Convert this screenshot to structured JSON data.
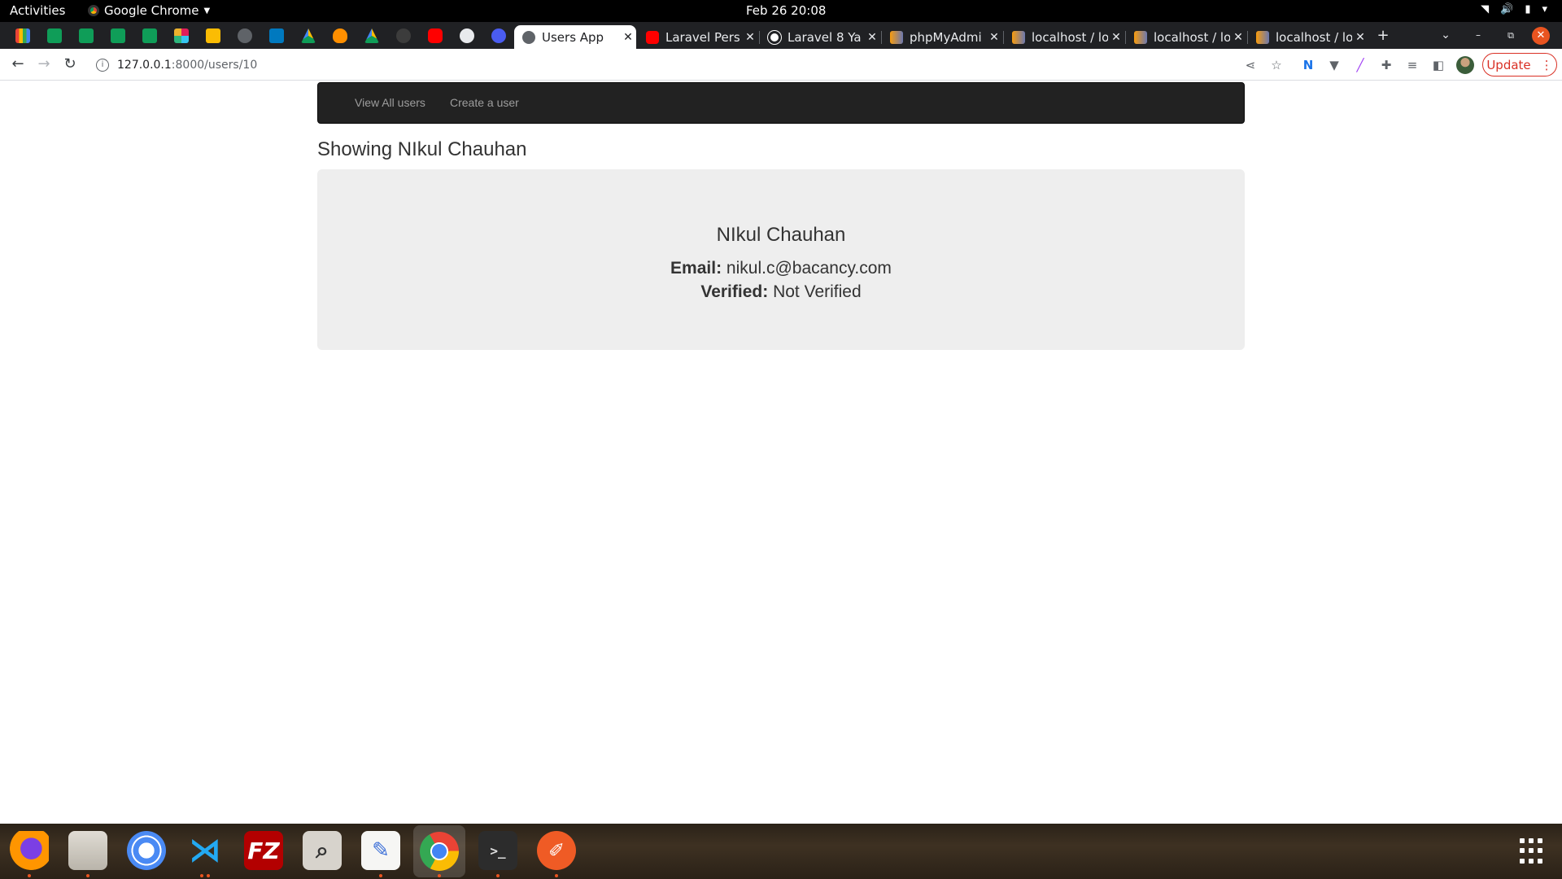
{
  "system_bar": {
    "activities": "Activities",
    "app_name": "Google Chrome",
    "clock": "Feb 26  20:08"
  },
  "tabs": [
    {
      "title": "Users App",
      "active": true
    },
    {
      "title": "Laravel Pers",
      "active": false
    },
    {
      "title": "Laravel 8 Ya",
      "active": false
    },
    {
      "title": "phpMyAdmi",
      "active": false
    },
    {
      "title": "localhost / lo",
      "active": false
    },
    {
      "title": "localhost / lo",
      "active": false
    },
    {
      "title": "localhost / lo",
      "active": false
    }
  ],
  "toolbar": {
    "url_host": "127.0.0.1",
    "url_path": ":8000/users/10",
    "update_label": "Update"
  },
  "navbar": {
    "links": [
      "View All users",
      "Create a user"
    ]
  },
  "page": {
    "heading": "Showing NIkul Chauhan",
    "user": {
      "name": "NIkul Chauhan",
      "email_label": "Email:",
      "email": "nikul.c@bacancy.com",
      "verified_label": "Verified:",
      "verified": "Not Verified"
    }
  },
  "colors": {
    "navbar_bg": "#222222",
    "jumbotron_bg": "#eeeeee",
    "update_red": "#d93025",
    "ubuntu_orange": "#e95420"
  },
  "dock_apps": [
    "firefox-icon",
    "files-icon",
    "chromium-icon",
    "vscode-icon",
    "filezilla-icon",
    "image-viewer-icon",
    "text-editor-icon",
    "chrome-icon",
    "terminal-icon",
    "postman-icon"
  ]
}
